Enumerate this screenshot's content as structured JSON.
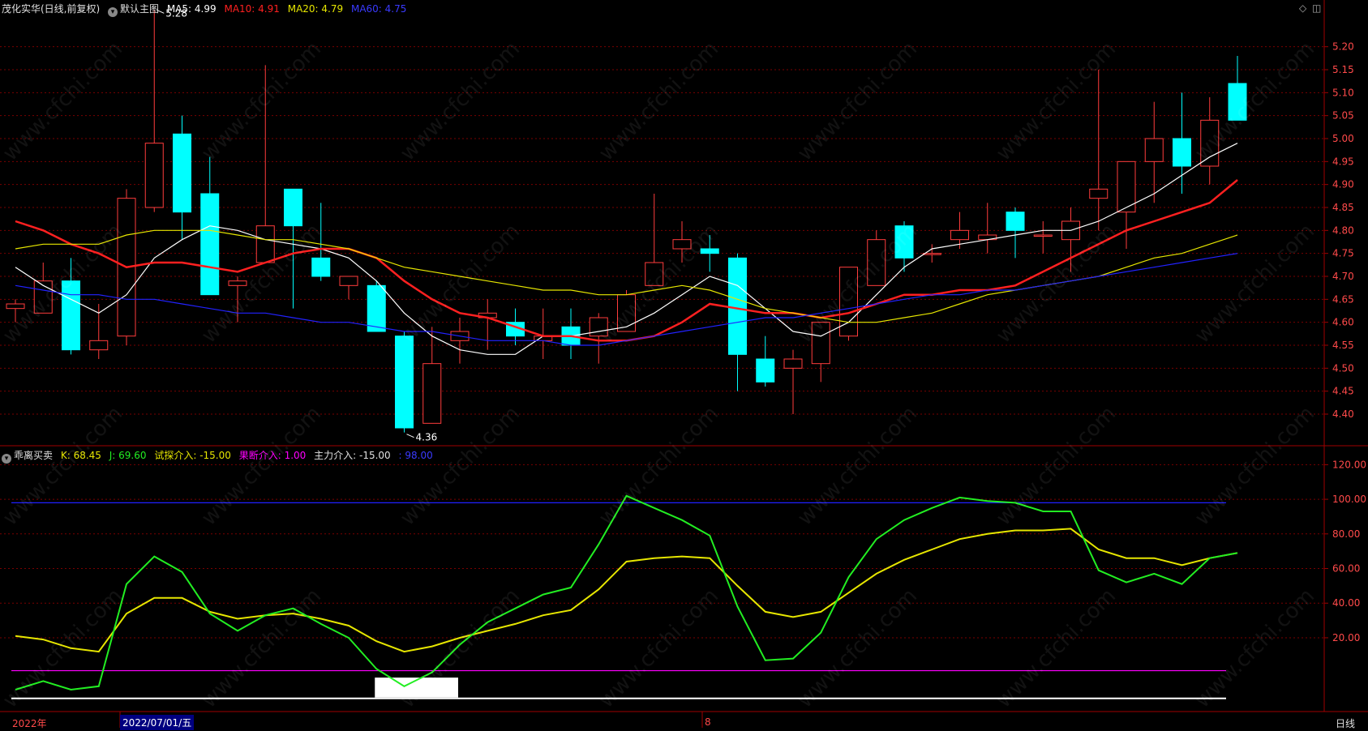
{
  "main_header": {
    "title": "茂化实华(日线,前复权)",
    "main_chart_label": "默认主图",
    "ma5": "MA5: 4.99",
    "ma10": "MA10: 4.91",
    "ma20": "MA20: 4.79",
    "ma60": "MA60: 4.75"
  },
  "sub_header": {
    "title": "乖离买卖",
    "k": "K: 68.45",
    "j": "J: 69.60",
    "try_in": "试探介入: -15.00",
    "decisive_in": "果断介入: 1.00",
    "main_in": "主力介入: -15.00",
    "last": ": 98.00"
  },
  "bottom_bar": {
    "year_label": "2022年",
    "cursor_date": "2022/07/01/五",
    "month_label": "8",
    "period": "日线"
  },
  "window_icons": {
    "diamond": "◇",
    "square": "◫"
  },
  "watermark": "www.cfchi.com",
  "colors": {
    "up": "#ff3c3c",
    "down": "#00ffff",
    "ma5": "#ffffff",
    "ma10": "#ff2020",
    "ma20": "#e6e600",
    "ma60": "#2222ff",
    "k": "#e6e600",
    "j": "#22ee22",
    "ref_blue": "#2020ff",
    "ref_magenta": "#ff00ff",
    "grid": "#7a0000",
    "axis_text": "#ff4a4a"
  },
  "chart_data": [
    {
      "type": "candlestick",
      "price_axis": {
        "ticks": [
          5.2,
          5.15,
          5.1,
          5.05,
          5.0,
          4.95,
          4.9,
          4.85,
          4.8,
          4.75,
          4.7,
          4.65,
          4.6,
          4.55,
          4.5,
          4.45,
          4.4
        ],
        "ylim": [
          4.34,
          5.27
        ]
      },
      "annotations": [
        {
          "text": "5.28",
          "index": 5,
          "value": 5.28
        },
        {
          "text": "4.36",
          "index": 14,
          "value": 4.36
        }
      ],
      "candles": [
        {
          "o": 4.63,
          "c": 4.64,
          "h": 4.65,
          "l": 4.6
        },
        {
          "o": 4.62,
          "c": 4.69,
          "h": 4.73,
          "l": 4.62
        },
        {
          "o": 4.69,
          "c": 4.54,
          "h": 4.74,
          "l": 4.53
        },
        {
          "o": 4.54,
          "c": 4.56,
          "h": 4.64,
          "l": 4.52
        },
        {
          "o": 4.57,
          "c": 4.87,
          "h": 4.89,
          "l": 4.55
        },
        {
          "o": 4.85,
          "c": 4.99,
          "h": 5.28,
          "l": 4.84
        },
        {
          "o": 5.01,
          "c": 4.84,
          "h": 5.05,
          "l": 4.78
        },
        {
          "o": 4.88,
          "c": 4.66,
          "h": 4.96,
          "l": 4.66
        },
        {
          "o": 4.68,
          "c": 4.69,
          "h": 4.7,
          "l": 4.6
        },
        {
          "o": 4.73,
          "c": 4.81,
          "h": 5.16,
          "l": 4.73
        },
        {
          "o": 4.89,
          "c": 4.81,
          "h": 4.89,
          "l": 4.63
        },
        {
          "o": 4.74,
          "c": 4.7,
          "h": 4.86,
          "l": 4.69
        },
        {
          "o": 4.68,
          "c": 4.7,
          "h": 4.7,
          "l": 4.65
        },
        {
          "o": 4.68,
          "c": 4.58,
          "h": 4.69,
          "l": 4.58
        },
        {
          "o": 4.57,
          "c": 4.37,
          "h": 4.58,
          "l": 4.36
        },
        {
          "o": 4.38,
          "c": 4.51,
          "h": 4.59,
          "l": 4.38
        },
        {
          "o": 4.56,
          "c": 4.58,
          "h": 4.61,
          "l": 4.51
        },
        {
          "o": 4.61,
          "c": 4.62,
          "h": 4.65,
          "l": 4.54
        },
        {
          "o": 4.6,
          "c": 4.57,
          "h": 4.63,
          "l": 4.55
        },
        {
          "o": 4.56,
          "c": 4.57,
          "h": 4.63,
          "l": 4.52
        },
        {
          "o": 4.59,
          "c": 4.55,
          "h": 4.63,
          "l": 4.52
        },
        {
          "o": 4.57,
          "c": 4.61,
          "h": 4.62,
          "l": 4.51
        },
        {
          "o": 4.58,
          "c": 4.66,
          "h": 4.67,
          "l": 4.58
        },
        {
          "o": 4.68,
          "c": 4.73,
          "h": 4.88,
          "l": 4.68
        },
        {
          "o": 4.76,
          "c": 4.78,
          "h": 4.82,
          "l": 4.73
        },
        {
          "o": 4.76,
          "c": 4.75,
          "h": 4.79,
          "l": 4.71
        },
        {
          "o": 4.74,
          "c": 4.53,
          "h": 4.75,
          "l": 4.45
        },
        {
          "o": 4.52,
          "c": 4.47,
          "h": 4.57,
          "l": 4.46
        },
        {
          "o": 4.5,
          "c": 4.52,
          "h": 4.54,
          "l": 4.4
        },
        {
          "o": 4.51,
          "c": 4.6,
          "h": 4.6,
          "l": 4.47
        },
        {
          "o": 4.57,
          "c": 4.72,
          "h": 4.72,
          "l": 4.56
        },
        {
          "o": 4.68,
          "c": 4.78,
          "h": 4.8,
          "l": 4.68
        },
        {
          "o": 4.81,
          "c": 4.74,
          "h": 4.82,
          "l": 4.71
        },
        {
          "o": 4.75,
          "c": 4.75,
          "h": 4.77,
          "l": 4.73
        },
        {
          "o": 4.78,
          "c": 4.8,
          "h": 4.84,
          "l": 4.76
        },
        {
          "o": 4.78,
          "c": 4.79,
          "h": 4.86,
          "l": 4.75
        },
        {
          "o": 4.84,
          "c": 4.8,
          "h": 4.85,
          "l": 4.74
        },
        {
          "o": 4.79,
          "c": 4.79,
          "h": 4.82,
          "l": 4.75
        },
        {
          "o": 4.78,
          "c": 4.82,
          "h": 4.85,
          "l": 4.71
        },
        {
          "o": 4.87,
          "c": 4.89,
          "h": 5.15,
          "l": 4.8
        },
        {
          "o": 4.84,
          "c": 4.95,
          "h": 4.95,
          "l": 4.76
        },
        {
          "o": 4.95,
          "c": 5.0,
          "h": 5.08,
          "l": 4.86
        },
        {
          "o": 5.0,
          "c": 4.94,
          "h": 5.1,
          "l": 4.88
        },
        {
          "o": 4.94,
          "c": 5.04,
          "h": 5.09,
          "l": 4.9
        },
        {
          "o": 5.12,
          "c": 5.04,
          "h": 5.18,
          "l": 5.04
        }
      ],
      "series": [
        {
          "name": "MA5",
          "values": [
            4.72,
            4.68,
            4.65,
            4.62,
            4.66,
            4.74,
            4.78,
            4.81,
            4.8,
            4.78,
            4.77,
            4.76,
            4.74,
            4.69,
            4.62,
            4.57,
            4.54,
            4.53,
            4.53,
            4.57,
            4.57,
            4.58,
            4.59,
            4.62,
            4.66,
            4.7,
            4.68,
            4.63,
            4.58,
            4.57,
            4.6,
            4.66,
            4.72,
            4.76,
            4.77,
            4.78,
            4.79,
            4.8,
            4.8,
            4.82,
            4.85,
            4.88,
            4.92,
            4.96,
            4.99
          ]
        },
        {
          "name": "MA10",
          "values": [
            4.82,
            4.8,
            4.77,
            4.75,
            4.72,
            4.73,
            4.73,
            4.72,
            4.71,
            4.73,
            4.75,
            4.76,
            4.76,
            4.74,
            4.69,
            4.65,
            4.62,
            4.61,
            4.59,
            4.57,
            4.57,
            4.56,
            4.56,
            4.57,
            4.6,
            4.64,
            4.63,
            4.62,
            4.62,
            4.61,
            4.62,
            4.64,
            4.66,
            4.66,
            4.67,
            4.67,
            4.68,
            4.71,
            4.74,
            4.77,
            4.8,
            4.82,
            4.84,
            4.86,
            4.91
          ]
        },
        {
          "name": "MA20",
          "values": [
            4.76,
            4.77,
            4.77,
            4.77,
            4.79,
            4.8,
            4.8,
            4.8,
            4.79,
            4.78,
            4.78,
            4.77,
            4.76,
            4.74,
            4.72,
            4.71,
            4.7,
            4.69,
            4.68,
            4.67,
            4.67,
            4.66,
            4.66,
            4.67,
            4.68,
            4.67,
            4.65,
            4.63,
            4.62,
            4.61,
            4.6,
            4.6,
            4.61,
            4.62,
            4.64,
            4.66,
            4.67,
            4.68,
            4.69,
            4.7,
            4.72,
            4.74,
            4.75,
            4.77,
            4.79
          ]
        },
        {
          "name": "MA60",
          "values": [
            4.68,
            4.67,
            4.66,
            4.66,
            4.65,
            4.65,
            4.64,
            4.63,
            4.62,
            4.62,
            4.61,
            4.6,
            4.6,
            4.59,
            4.58,
            4.58,
            4.57,
            4.56,
            4.56,
            4.56,
            4.55,
            4.55,
            4.56,
            4.57,
            4.58,
            4.59,
            4.6,
            4.61,
            4.61,
            4.62,
            4.63,
            4.64,
            4.65,
            4.66,
            4.66,
            4.67,
            4.67,
            4.68,
            4.69,
            4.7,
            4.71,
            4.72,
            4.73,
            4.74,
            4.75
          ]
        }
      ]
    },
    {
      "type": "line",
      "title": "乖离买卖",
      "y_ticks": [
        120,
        100,
        80,
        60,
        40,
        20
      ],
      "ylim": [
        -17,
        130
      ],
      "reference_lines": [
        {
          "name": "blue",
          "value": 98
        },
        {
          "name": "magenta",
          "value": 1
        },
        {
          "name": "white",
          "value": -15
        }
      ],
      "series": [
        {
          "name": "K",
          "values": [
            21,
            19,
            14,
            12,
            34,
            43,
            43,
            35,
            31,
            33,
            34,
            31,
            27,
            18,
            12,
            15,
            20,
            24,
            28,
            33,
            36,
            48,
            64,
            66,
            67,
            66,
            50,
            35,
            32,
            35,
            46,
            57,
            65,
            71,
            77,
            80,
            82,
            82,
            83,
            71,
            66,
            66,
            62,
            66,
            69
          ]
        },
        {
          "name": "J",
          "values": [
            -10,
            -5,
            -10,
            -8,
            51,
            67,
            58,
            34,
            24,
            33,
            37,
            28,
            20,
            2,
            -8,
            0,
            16,
            29,
            37,
            45,
            49,
            74,
            102,
            95,
            88,
            79,
            38,
            7,
            8,
            23,
            55,
            77,
            88,
            95,
            101,
            99,
            98,
            93,
            93,
            59,
            52,
            57,
            51,
            66,
            69
          ]
        }
      ]
    }
  ]
}
